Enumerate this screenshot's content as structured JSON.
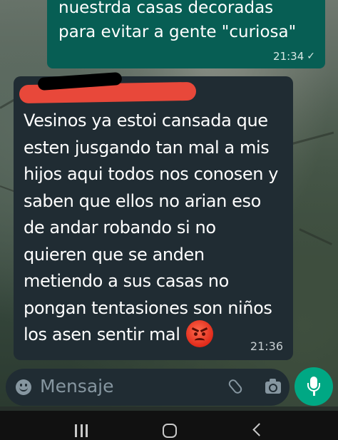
{
  "outgoing_message": {
    "lines": [
      "nuestrda casas decoradas",
      "para evitar a gente \"curiosa\""
    ],
    "time": "21:34",
    "status_icon": "single-check-icon"
  },
  "incoming_message": {
    "lines": [
      "Vesinos ya estoi cansada que",
      "esten jusgando tan mal a mis",
      "hijos aqui todos nos conosen y",
      "saben que ellos no arian eso",
      "de andar robando si no",
      "quieren que se anden",
      "metiendo a sus casas no",
      "pongan tentasiones son niños",
      "los asen sentir mal"
    ],
    "emoji": "angry-face-emoji",
    "time": "21:36",
    "sender_redacted": true
  },
  "composer": {
    "placeholder": "Mensaje",
    "icons": [
      "emoji-icon",
      "paperclip-icon",
      "camera-icon",
      "microphone-icon"
    ]
  },
  "system_nav": {
    "icons": [
      "recents-icon",
      "home-icon",
      "back-icon"
    ]
  },
  "colors": {
    "outgoing_bubble": "#075e54",
    "incoming_bubble": "#202c33",
    "mic_button": "#00a884",
    "redaction_red": "#e8483a"
  }
}
